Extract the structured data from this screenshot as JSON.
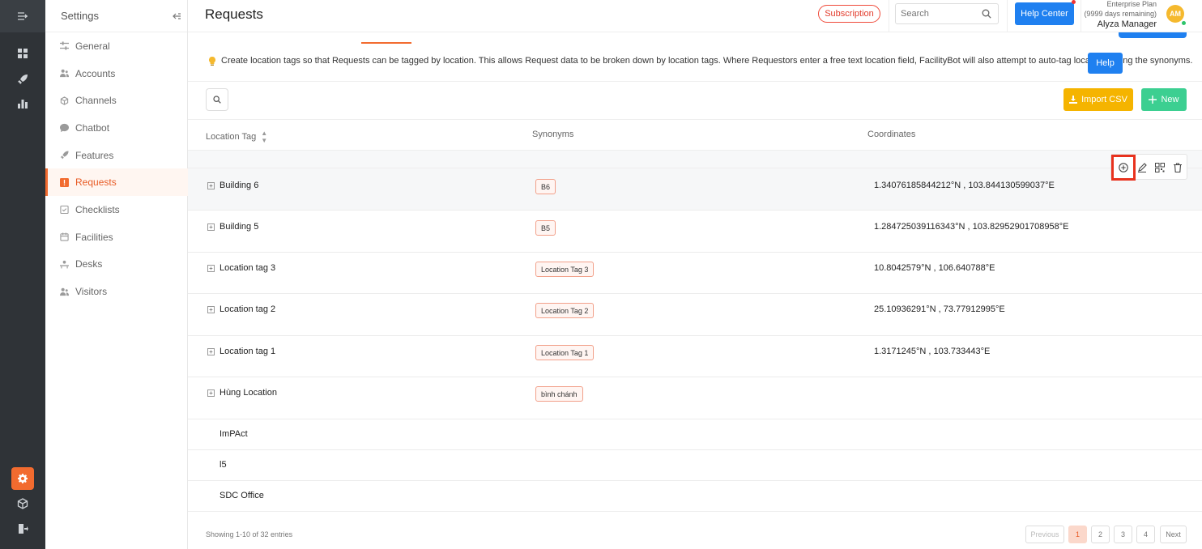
{
  "rail": {
    "icons": [
      "menu-expand-icon",
      "dashboard-icon",
      "rocket-icon",
      "analytics-icon",
      "settings-icon",
      "cube-icon",
      "logout-icon"
    ]
  },
  "sidebar": {
    "title": "Settings",
    "items": [
      {
        "label": "General",
        "icon": "sliders-icon"
      },
      {
        "label": "Accounts",
        "icon": "users-icon"
      },
      {
        "label": "Channels",
        "icon": "cube-icon"
      },
      {
        "label": "Chatbot",
        "icon": "chat-icon"
      },
      {
        "label": "Features",
        "icon": "rocket-icon"
      },
      {
        "label": "Requests",
        "icon": "request-icon",
        "active": true
      },
      {
        "label": "Checklists",
        "icon": "checklist-icon"
      },
      {
        "label": "Facilities",
        "icon": "calendar-icon"
      },
      {
        "label": "Desks",
        "icon": "desk-icon"
      },
      {
        "label": "Visitors",
        "icon": "visitors-icon"
      }
    ]
  },
  "header": {
    "title": "Requests",
    "subscription": "Subscription",
    "search_placeholder": "Search",
    "help_center": "Help Center",
    "plan_line1": "Enterprise Plan",
    "plan_line2": "(9999 days remaining)",
    "user_name": "Alyza Manager",
    "avatar_initials": "AM"
  },
  "hint": {
    "text": "Create location tags so that Requests can be tagged by location. This allows Request data to be broken down by location tags. Where Requestors enter a free text location field, FacilityBot will also attempt to auto-tag locations using the synonyms.",
    "help_label": "Help"
  },
  "toolbar": {
    "import_label": "Import CSV",
    "new_label": "New"
  },
  "table": {
    "columns": [
      "Location Tag",
      "Synonyms",
      "Coordinates"
    ],
    "rows": [
      {
        "name": "Building 6",
        "synonym": "B6",
        "coords": "1.34076185844212°N , 103.844130599037°E",
        "expandable": true
      },
      {
        "name": "Building 5",
        "synonym": "B5",
        "coords": "1.284725039116343°N , 103.82952901708958°E",
        "expandable": true
      },
      {
        "name": "Location tag 3",
        "synonym": "Location Tag 3",
        "coords": "10.8042579°N , 106.640788°E",
        "expandable": true
      },
      {
        "name": "Location tag 2",
        "synonym": "Location Tag 2",
        "coords": "25.10936291°N , 73.77912995°E",
        "expandable": true
      },
      {
        "name": "Location tag 1",
        "synonym": "Location Tag 1",
        "coords": "1.3171245°N , 103.733443°E",
        "expandable": true
      },
      {
        "name": "Hùng Location",
        "synonym": "bình chánh",
        "coords": "",
        "expandable": true
      },
      {
        "name": "ImPAct",
        "synonym": "",
        "coords": "",
        "expandable": false
      },
      {
        "name": "l5",
        "synonym": "",
        "coords": "",
        "expandable": false
      },
      {
        "name": "SDC Office",
        "synonym": "",
        "coords": "",
        "expandable": false
      }
    ],
    "row_actions": [
      "add-circle-icon",
      "edit-icon",
      "qr-code-icon",
      "trash-icon"
    ]
  },
  "pagination": {
    "showing": "Showing 1-10 of 32 entries",
    "previous": "Previous",
    "pages": [
      "1",
      "2",
      "3",
      "4"
    ],
    "current": "1",
    "next": "Next"
  },
  "colors": {
    "accent": "#f26b2f",
    "primary": "#1f80f0",
    "import": "#f5b400",
    "new": "#3ccf91",
    "rail": "#2f3337"
  }
}
